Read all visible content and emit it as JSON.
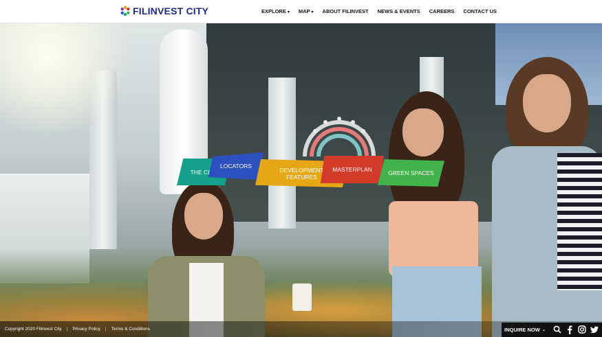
{
  "header": {
    "logo_text": "FILINVEST CITY",
    "nav": [
      {
        "label": "EXPLORE",
        "dropdown": true
      },
      {
        "label": "MAP",
        "dropdown": true
      },
      {
        "label": "ABOUT FILINVEST",
        "dropdown": false
      },
      {
        "label": "NEWS & EVENTS",
        "dropdown": false
      },
      {
        "label": "CAREERS",
        "dropdown": false
      },
      {
        "label": "CONTACT US",
        "dropdown": false
      }
    ]
  },
  "hero_nav": {
    "the_city": "THE CITY",
    "locators": "LOCATORS",
    "development_features": "DEVELOPMENT FEATURES",
    "masterplan": "MASTERPLAN",
    "green_spaces": "GREEN SPACES",
    "colors": {
      "the_city": "#14a08a",
      "locators": "#2c50c0",
      "development_features": "#e5a814",
      "masterplan": "#d23a2a",
      "green_spaces": "#42b24b"
    }
  },
  "footer": {
    "copyright": "Copyright 2020 Filinvest City",
    "privacy": "Privacy Policy",
    "terms": "Terms & Conditions",
    "inquire": "INQUIRE NOW",
    "social_icons": [
      "search-icon",
      "facebook-icon",
      "instagram-icon",
      "twitter-icon"
    ]
  }
}
